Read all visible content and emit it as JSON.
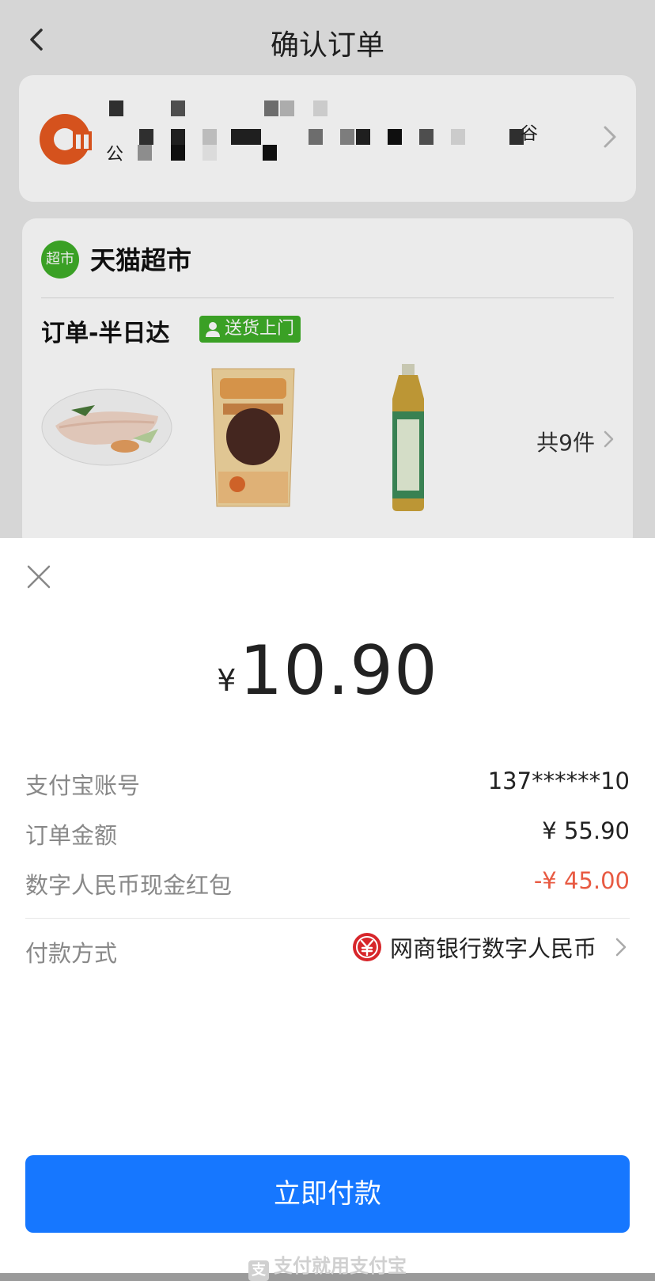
{
  "nav": {
    "title": "确认订单",
    "back_icon": "chevron-left-icon"
  },
  "address": {
    "line1_fragment": "公",
    "line2_fragment": "谷"
  },
  "store": {
    "badge": "超市",
    "name": "天猫超市",
    "order_label": "订单-半日达",
    "delivery_tag": "送货上门",
    "item_count": "共9件",
    "products": [
      "fish-fillet",
      "snack-pack",
      "green-tea-bottle"
    ]
  },
  "payment_sheet": {
    "currency_symbol": "¥",
    "amount": "10.90",
    "rows": [
      {
        "label": "支付宝账号",
        "value": "137******10"
      },
      {
        "label": "订单金额",
        "value": "¥ 55.90"
      },
      {
        "label": "数字人民币现金红包",
        "value": "-¥ 45.00"
      }
    ],
    "method_label": "付款方式",
    "method_value": "网商银行数字人民币",
    "pay_button": "立即付款",
    "footer": "支付就用支付宝",
    "footer_logo": "支",
    "colors": {
      "accent": "#1677ff",
      "discount": "#e85a42",
      "brand_green": "#3fae29"
    }
  }
}
